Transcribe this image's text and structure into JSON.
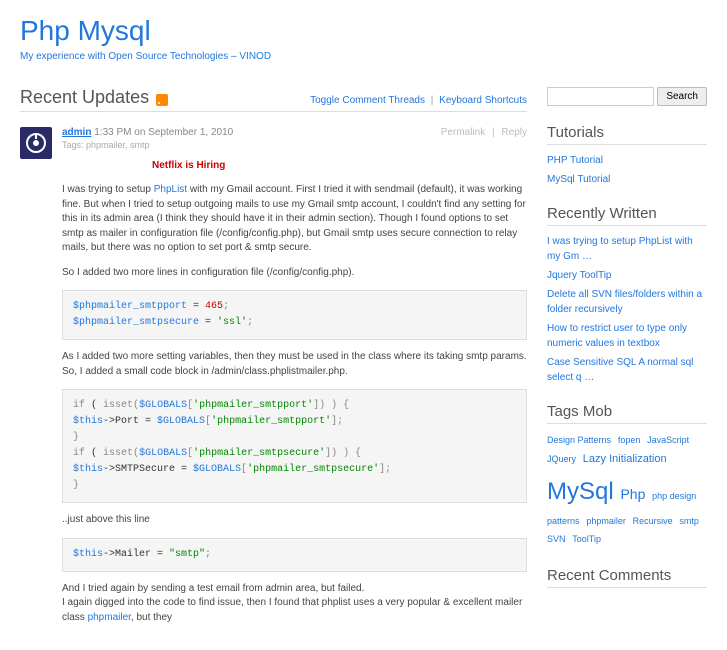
{
  "header": {
    "title": "Php Mysql",
    "tagline": "My experience with Open Source Technologies – VINOD"
  },
  "section": {
    "title": "Recent Updates",
    "toggle_link": "Toggle Comment Threads",
    "shortcuts_link": "Keyboard Shortcuts"
  },
  "post": {
    "author": "admin",
    "time": "1:33 PM on September 1, 2010",
    "permalink": "Permalink",
    "reply": "Reply",
    "tags_label": "Tags: phpmailer, smtp",
    "ad": "Netflix is Hiring",
    "p1_a": "I was trying to setup ",
    "p1_link": "PhpList",
    "p1_b": " with my Gmail account. First I tried it with sendmail (default), it was working fine. But when I tried to setup outgoing mails to use my Gmail smtp account, I couldn't find any setting for this in its admin area (I think they should have it in their admin section). Though I found options to set smtp as mailer in configuration file (/config/config.php), but Gmail smtp uses secure connection to relay mails, but there was no option to set port & smtp secure.",
    "p2": "So I added two more lines in configuration file (/config/config.php).",
    "p3": "As I added two more setting variables, then they must be used in the class where its taking smtp params. So, I added a small code block in /admin/class.phplistmailer.php.",
    "p4": "..just above this line",
    "p5_a": "And I tried again by sending a test email from admin area, but failed.",
    "p5_b": "I again digged into the code to find issue, then I found that phplist uses a very popular & excellent mailer class ",
    "p5_link": "phpmailer",
    "p5_c": ", but they"
  },
  "code": {
    "c1_l1_a": "$phpmailer_smtpport",
    "c1_l1_b": " = ",
    "c1_l1_c": "465",
    "c1_l1_d": ";",
    "c1_l2_a": "$phpmailer_smtpsecure",
    "c1_l2_b": " = ",
    "c1_l2_c": "'ssl'",
    "c1_l2_d": ";",
    "c2_l1_a": "if",
    "c2_l1_b": " ( ",
    "c2_l1_c": "isset",
    "c2_l1_d": "(",
    "c2_l1_e": "$GLOBALS",
    "c2_l1_f": "[",
    "c2_l1_g": "'phpmailer_smtpport'",
    "c2_l1_h": "]) ) {",
    "c2_l2_a": "$this",
    "c2_l2_b": "->Port = ",
    "c2_l2_c": "$GLOBALS",
    "c2_l2_d": "[",
    "c2_l2_e": "'phpmailer_smtpport'",
    "c2_l2_f": "];",
    "c2_l3": "}",
    "c2_l4_a": "if",
    "c2_l4_b": " ( ",
    "c2_l4_c": "isset",
    "c2_l4_d": "(",
    "c2_l4_e": "$GLOBALS",
    "c2_l4_f": "[",
    "c2_l4_g": "'phpmailer_smtpsecure'",
    "c2_l4_h": "]) ) {",
    "c2_l5_a": "$this",
    "c2_l5_b": "->SMTPSecure = ",
    "c2_l5_c": "$GLOBALS",
    "c2_l5_d": "[",
    "c2_l5_e": "'phpmailer_smtpsecure'",
    "c2_l5_f": "];",
    "c2_l6": "}",
    "c3_l1_a": "$this",
    "c3_l1_b": "->Mailer = ",
    "c3_l1_c": "\"smtp\"",
    "c3_l1_d": ";"
  },
  "sidebar": {
    "search_btn": "Search",
    "tutorials_title": "Tutorials",
    "tutorials": [
      "PHP Tutorial",
      "MySql Tutorial"
    ],
    "recent_title": "Recently Written",
    "recent": [
      "I was trying to setup PhpList with my Gm …",
      "Jquery ToolTip",
      "Delete all SVN files/folders within a folder recursively",
      "How to restrict user to type only numeric values in textbox",
      "Case Sensitive SQL A normal sql select q …"
    ],
    "tags_title": "Tags Mob",
    "tags": [
      {
        "t": "Design Patterns",
        "s": "s"
      },
      {
        "t": "fopen",
        "s": "s"
      },
      {
        "t": "JavaScript",
        "s": "s"
      },
      {
        "t": "JQuery",
        "s": "s"
      },
      {
        "t": "Lazy Initialization",
        "s": "m"
      },
      {
        "t": "MySql",
        "s": "xl"
      },
      {
        "t": "Php",
        "s": "l"
      },
      {
        "t": "php design patterns",
        "s": "s"
      },
      {
        "t": "phpmailer",
        "s": "s"
      },
      {
        "t": "Recursive",
        "s": "s"
      },
      {
        "t": "smtp",
        "s": "s"
      },
      {
        "t": "SVN",
        "s": "s"
      },
      {
        "t": "ToolTip",
        "s": "s"
      }
    ],
    "comments_title": "Recent Comments"
  }
}
